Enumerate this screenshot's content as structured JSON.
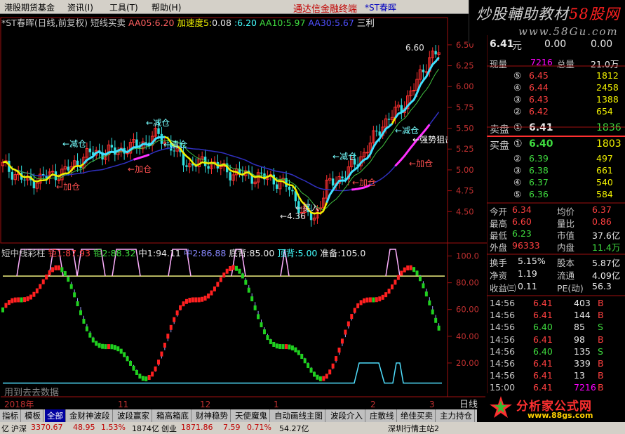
{
  "menubar": {
    "items": [
      "港股期货基金",
      "资讯(I)",
      "工具(T)",
      "帮助(H)"
    ],
    "center_title": "通达信金融终端",
    "stock_tag": "*ST春晖"
  },
  "watermark_top": {
    "text": "炒股輔助教材",
    "highlight": "58股网",
    "url": "www.58Gu.com"
  },
  "chart_info": {
    "title": "*ST春晖(日线,前复权)",
    "indicator": "短线买卖",
    "aa05_label": "AA05:",
    "aa05": "6.20",
    "speed_label": "加速度5:",
    "speed": "0.08",
    "colon": ":",
    "aa10_pre": "6.20",
    "aa10_label": "AA10:",
    "aa10": "5.97",
    "aa30_label": "AA30:",
    "aa30": "5.67",
    "end": "三利"
  },
  "price_axis": [
    "6.50",
    "6.25",
    "6.00",
    "5.75",
    "5.50",
    "5.25",
    "5.00",
    "4.75",
    "4.50"
  ],
  "annotations": {
    "high": "6.60",
    "low": "4.36",
    "buy": "买入",
    "reduce": "减仓",
    "clear": "清仓",
    "add": "加仓",
    "strong": "强势狙击"
  },
  "indicator_info": {
    "name": "短中线彩柱",
    "j1_label": "钜1:",
    "j1": "87.93",
    "j2_label": "钜2:",
    "j2": "88.32",
    "mid_label": "中1:",
    "mid": "94.11",
    "mid2_label": "中2:",
    "mid2": "86.88",
    "bottom_label": "底背:",
    "bottom": "85.00",
    "top_label": "顶背:",
    "top": "5.00",
    "prep_label": "准备:",
    "prep": "105.0"
  },
  "ind_axis": [
    "100.0",
    "80.00",
    "60.00",
    "40.00",
    "20.00"
  ],
  "ind_watermark": "用到去去数据",
  "date_axis": [
    "2018年",
    "11",
    "12",
    "1",
    "2",
    "3"
  ],
  "period": "日线",
  "right_panel": {
    "price": "6.41",
    "price_unit": "元",
    "change": "0.00",
    "pct": "0.00",
    "vol_label": "现量",
    "vol": "7216",
    "total_label": "总量",
    "total": "21.0万",
    "asks": [
      {
        "n": "⑤",
        "p": "6.45",
        "v": "1812"
      },
      {
        "n": "④",
        "p": "6.44",
        "v": "2458"
      },
      {
        "n": "③",
        "p": "6.43",
        "v": "1388"
      },
      {
        "n": "②",
        "p": "6.42",
        "v": "654"
      },
      {
        "n": "①",
        "p": "6.41",
        "v": "1836",
        "label": "卖盘"
      }
    ],
    "bids": [
      {
        "n": "①",
        "p": "6.40",
        "v": "1803",
        "label": "买盘"
      },
      {
        "n": "②",
        "p": "6.39",
        "v": "497"
      },
      {
        "n": "③",
        "p": "6.38",
        "v": "661"
      },
      {
        "n": "④",
        "p": "6.37",
        "v": "540"
      },
      {
        "n": "⑤",
        "p": "6.36",
        "v": "584"
      }
    ],
    "stats": [
      {
        "a": "今开",
        "av": "6.34",
        "b": "均价",
        "bv": "6.37"
      },
      {
        "a": "最高",
        "av": "6.60",
        "b": "量比",
        "bv": "0.86"
      },
      {
        "a": "最低",
        "av": "6.23",
        "b": "市值",
        "bv": "37.6亿"
      },
      {
        "a": "外盘",
        "av": "96333",
        "b": "内盘",
        "bv": "11.4万"
      }
    ],
    "fin": [
      {
        "a": "换手",
        "av": "5.15%",
        "b": "股本",
        "bv": "5.87亿"
      },
      {
        "a": "净资",
        "av": "1.19",
        "b": "流通",
        "bv": "4.09亿"
      },
      {
        "a": "收益㈢",
        "av": "0.11",
        "b": "PE(动)",
        "bv": "56.3"
      }
    ],
    "ticks": [
      {
        "t": "14:56",
        "p": "6.41",
        "v": "403",
        "d": "B"
      },
      {
        "t": "14:56",
        "p": "6.41",
        "v": "144",
        "d": "B"
      },
      {
        "t": "14:56",
        "p": "6.40",
        "v": "85",
        "d": "S"
      },
      {
        "t": "14:56",
        "p": "6.41",
        "v": "98",
        "d": "B"
      },
      {
        "t": "14:56",
        "p": "6.40",
        "v": "135",
        "d": "S"
      },
      {
        "t": "14:56",
        "p": "6.41",
        "v": "339",
        "d": "B"
      },
      {
        "t": "14:56",
        "p": "6.41",
        "v": "13",
        "d": "B"
      },
      {
        "t": "15:00",
        "p": "6.41",
        "v": "7216",
        "d": "B"
      }
    ]
  },
  "tabs": [
    "指标",
    "模板",
    "全部",
    "金财神波段",
    "波段赢家",
    "箱高箱底",
    "财神稳势",
    "天使魔鬼",
    "自动画线主图",
    "波段介入",
    "庄散线",
    "绝佳买卖",
    "主力持仓"
  ],
  "watermark_bottom": {
    "text": "分析家公式网",
    "url": "www.88gs.com"
  },
  "status": {
    "prefix": "亿",
    "index1": "沪深",
    "v1": "3370.67",
    "c1": "48.95",
    "p1": "1.53%",
    "a1": "1874亿",
    "index2": "创业",
    "v2": "1871.86",
    "c2": "7.59",
    "p2": "0.71%",
    "a2": "54.27亿",
    "news": "深圳行情主站2"
  }
}
